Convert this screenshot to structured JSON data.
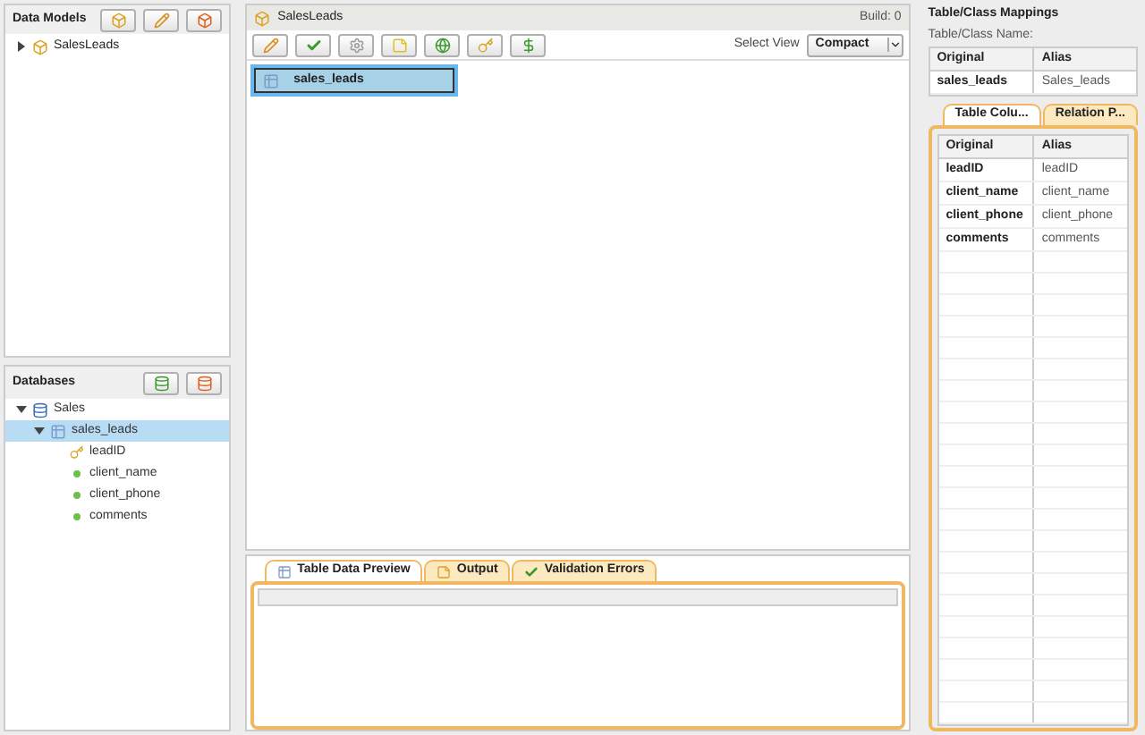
{
  "data_models": {
    "title": "Data Models",
    "tree": [
      {
        "label": "SalesLeads",
        "expanded": false
      }
    ]
  },
  "databases": {
    "title": "Databases",
    "tree": [
      {
        "label": "Sales",
        "kind": "database",
        "expanded": true,
        "selected": false,
        "children": [
          {
            "label": "sales_leads",
            "kind": "table",
            "expanded": true,
            "selected": true,
            "children": [
              {
                "label": "leadID",
                "kind": "key",
                "selected": false
              },
              {
                "label": "client_name",
                "kind": "column",
                "selected": false
              },
              {
                "label": "client_phone",
                "kind": "column",
                "selected": false
              },
              {
                "label": "comments",
                "kind": "column",
                "selected": false
              }
            ]
          }
        ]
      }
    ]
  },
  "editor": {
    "title": "SalesLeads",
    "build": "Build: 0",
    "select_view_label": "Select View",
    "select_view_value": "Compact",
    "entities": [
      {
        "label": "sales_leads",
        "selected": true
      }
    ]
  },
  "bottom_tabs": [
    {
      "label": "Table Data Preview",
      "kind": "table",
      "selected": true
    },
    {
      "label": "Output",
      "kind": "output",
      "selected": false
    },
    {
      "label": "Validation Errors",
      "kind": "validation",
      "selected": false
    }
  ],
  "mappings": {
    "title": "Table/Class Mappings",
    "name_label": "Table/Class Name:",
    "columns": [
      "Original",
      "Alias"
    ],
    "rows": [
      [
        "sales_leads",
        "Sales_leads"
      ]
    ]
  },
  "right_tabs": [
    {
      "label": "Table Colu...",
      "selected": true
    },
    {
      "label": "Relation P...",
      "selected": false
    }
  ],
  "column_table": {
    "columns": [
      "Original",
      "Alias"
    ],
    "rows": [
      [
        "leadID",
        "leadID"
      ],
      [
        "client_name",
        "client_name"
      ],
      [
        "client_phone",
        "client_phone"
      ],
      [
        "comments",
        "comments"
      ]
    ]
  }
}
